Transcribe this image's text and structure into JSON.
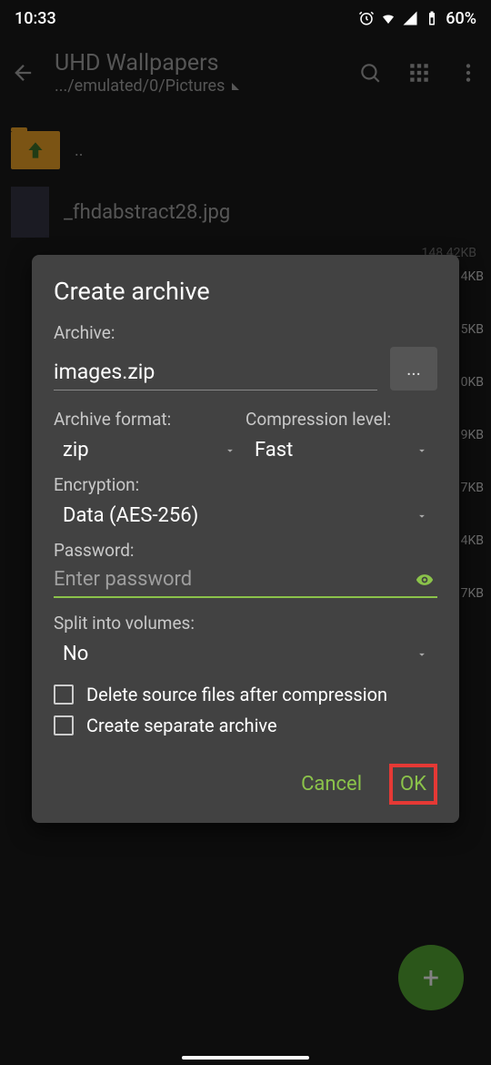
{
  "statusbar": {
    "time": "10:33",
    "battery": "60%"
  },
  "appbar": {
    "title": "UHD Wallpapers",
    "subtitle": ".../emulated/0/Pictures"
  },
  "files": {
    "up_dots": "..",
    "items": [
      {
        "name": "_fhdabstract28.jpg",
        "size": "148.42KB"
      }
    ],
    "side_sizes": [
      "4KB",
      "5KB",
      "0KB",
      "9KB",
      "7KB",
      "4KB",
      "7KB"
    ]
  },
  "dialog": {
    "title": "Create archive",
    "archive_label": "Archive:",
    "archive_value": "images.zip",
    "dots": "...",
    "format_label": "Archive format:",
    "format_value": "zip",
    "compression_label": "Compression level:",
    "compression_value": "Fast",
    "encryption_label": "Encryption:",
    "encryption_value": "Data (AES-256)",
    "password_label": "Password:",
    "password_placeholder": "Enter password",
    "split_label": "Split into volumes:",
    "split_value": "No",
    "delete_label": "Delete source files after compression",
    "separate_label": "Create separate archive",
    "cancel": "Cancel",
    "ok": "OK"
  },
  "fab": {
    "plus": "+"
  }
}
